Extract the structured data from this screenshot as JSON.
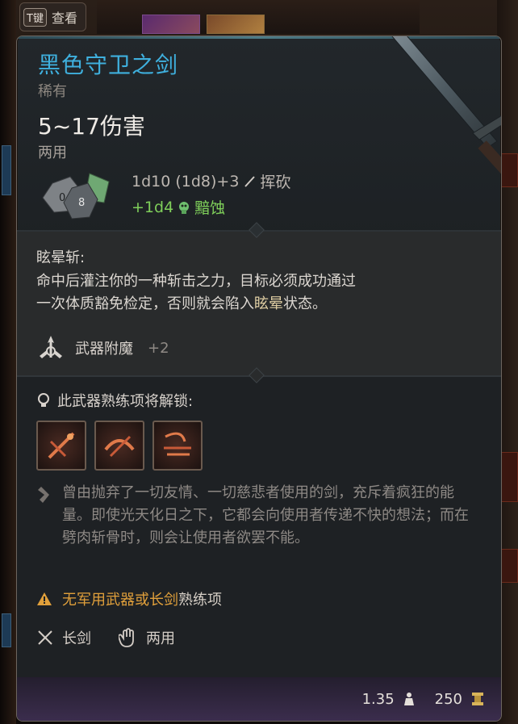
{
  "hotkey": {
    "key": "T键",
    "label": "查看"
  },
  "item": {
    "name": "黑色守卫之剑",
    "rarity": "稀有",
    "damage": "5~17伤害",
    "handedness": "两用",
    "damage_line1": "1d10 (1d8)+3",
    "damage_type1": "挥砍",
    "damage_line2": "+1d4",
    "damage_type2": "黯蚀",
    "dice_labels": [
      "0",
      "8"
    ],
    "colors": {
      "name": "#3fb0de",
      "bonus": "#7fcf5a",
      "warning": "#e1a03b"
    }
  },
  "ability": {
    "name": "眩晕斩:",
    "desc_a": "命中后灌注你的一种斩击之力，目标必须成功通过",
    "desc_b": "一次体质豁免检定，否则就会陷入",
    "desc_hl": "眩晕",
    "desc_c": "状态。"
  },
  "enchant": {
    "label": "武器附魔",
    "value": "+2",
    "icon": "enchant-icon"
  },
  "proficiency": {
    "header": "此武器熟练项将解锁:",
    "actions": [
      {
        "name": "cleave-action-icon"
      },
      {
        "name": "piercing-action-icon"
      },
      {
        "name": "flourish-action-icon"
      }
    ]
  },
  "lore": "曾由抛弃了一切友情、一切慈悲者使用的剑，充斥着疯狂的能量。即使光天化日之下，它都会向使用者传递不快的想法；而在劈肉斩骨时，则会让使用者欲罢不能。",
  "warning": {
    "prefix": "无",
    "text": "军用武器或长剑",
    "suffix": "熟练项"
  },
  "properties": [
    {
      "label": "长剑",
      "icon": "longsword-icon"
    },
    {
      "label": "两用",
      "icon": "hand-icon"
    }
  ],
  "footer": {
    "weight": "1.35",
    "value": "250"
  }
}
